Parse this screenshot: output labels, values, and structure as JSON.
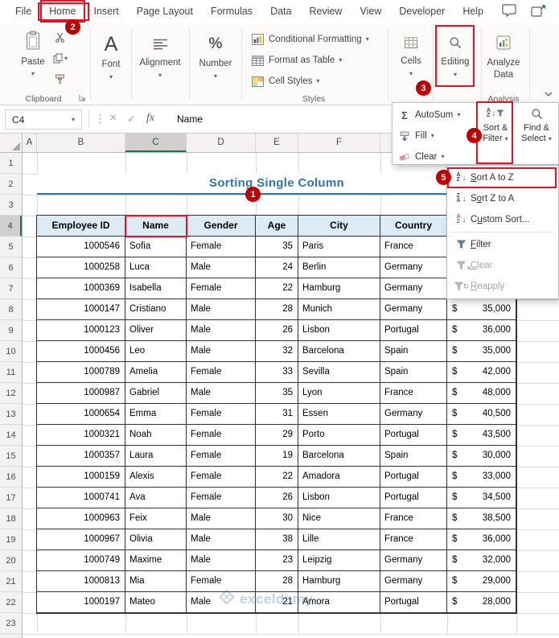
{
  "colors": {
    "annotation_red": "#c00000",
    "excel_green": "#107c41",
    "title_blue": "#2e74b5",
    "table_header_fill": "#ddebf7"
  },
  "ribbon": {
    "tabs": [
      "File",
      "Home",
      "Insert",
      "Page Layout",
      "Formulas",
      "Data",
      "Review",
      "View",
      "Developer",
      "Help"
    ],
    "active_tab": "Home",
    "paste_label": "Paste",
    "clipboard_group": "Clipboard",
    "font_label": "Font",
    "alignment_label": "Alignment",
    "number_label": "Number",
    "styles_items": [
      "Conditional Formatting",
      "Format as Table",
      "Cell Styles"
    ],
    "styles_group": "Styles",
    "cells_label": "Cells",
    "editing_label": "Editing",
    "analyze_label": "Analyze Data",
    "analysis_group": "Analysis"
  },
  "editing_panel": {
    "autosum_label": "AutoSum",
    "fill_label": "Fill",
    "clear_label": "Clear",
    "sort_filter_label": "Sort & Filter",
    "find_select_label": "Find & Select"
  },
  "sort_menu": {
    "items": [
      {
        "label": "Sort A to Z",
        "accel": "S",
        "disabled": false
      },
      {
        "label": "Sort Z to A",
        "accel": "o",
        "disabled": false
      },
      {
        "label": "Custom Sort...",
        "accel": "u",
        "disabled": false
      },
      {
        "label": "Filter",
        "accel": "F",
        "disabled": false
      },
      {
        "label": "Clear",
        "accel": "C",
        "disabled": true
      },
      {
        "label": "Reapply",
        "accel": "R",
        "disabled": true
      }
    ]
  },
  "formula_bar": {
    "name_box": "C4",
    "fx_label": "fx",
    "value": "Name"
  },
  "sheet": {
    "title": "Sorting Single Column",
    "visible_columns": [
      "A",
      "B",
      "C",
      "D",
      "E",
      "F"
    ],
    "selected_column": "C",
    "selected_row": 4,
    "row_numbers": [
      "1",
      "2",
      "3",
      "4",
      "5",
      "6",
      "7",
      "8",
      "9",
      "10",
      "11",
      "12",
      "13",
      "14",
      "15",
      "16",
      "17",
      "18",
      "19",
      "20",
      "21",
      "22",
      "23"
    ],
    "table": {
      "currency_symbol": "$",
      "headers": [
        "Employee ID",
        "Name",
        "Gender",
        "Age",
        "City",
        "Country",
        ""
      ],
      "rows": [
        [
          "1000546",
          "Sofia",
          "Female",
          "35",
          "Paris",
          "France",
          ""
        ],
        [
          "1000258",
          "Luca",
          "Male",
          "24",
          "Berlin",
          "Germany",
          ""
        ],
        [
          "1000369",
          "Isabella",
          "Female",
          "22",
          "Hamburg",
          "Germany",
          ""
        ],
        [
          "1000147",
          "Cristiano",
          "Male",
          "28",
          "Munich",
          "Germany",
          "35,000"
        ],
        [
          "1000123",
          "Oliver",
          "Male",
          "26",
          "Lisbon",
          "Portugal",
          "36,000"
        ],
        [
          "1000456",
          "Leo",
          "Male",
          "32",
          "Barcelona",
          "Spain",
          "35,000"
        ],
        [
          "1000789",
          "Amelia",
          "Female",
          "33",
          "Sevilla",
          "Spain",
          "42,000"
        ],
        [
          "1000987",
          "Gabriel",
          "Male",
          "35",
          "Lyon",
          "France",
          "48,000"
        ],
        [
          "1000654",
          "Emma",
          "Female",
          "31",
          "Essen",
          "Germany",
          "40,500"
        ],
        [
          "1000321",
          "Noah",
          "Female",
          "29",
          "Porto",
          "Portugal",
          "43,500"
        ],
        [
          "1000357",
          "Laura",
          "Female",
          "19",
          "Barcelona",
          "Spain",
          "30,000"
        ],
        [
          "1000159",
          "Alexis",
          "Female",
          "22",
          "Amadora",
          "Portugal",
          "33,000"
        ],
        [
          "1000741",
          "Ava",
          "Female",
          "26",
          "Lisbon",
          "Portugal",
          "34,500"
        ],
        [
          "1000963",
          "Feix",
          "Male",
          "30",
          "Nice",
          "France",
          "38,500"
        ],
        [
          "1000967",
          "Olivia",
          "Male",
          "38",
          "Lille",
          "France",
          "36,000"
        ],
        [
          "1000749",
          "Maxime",
          "Male",
          "23",
          "Leipzig",
          "Germany",
          "32,000"
        ],
        [
          "1000813",
          "Mia",
          "Female",
          "28",
          "Hamburg",
          "Germany",
          "29,000"
        ],
        [
          "1000197",
          "Mateo",
          "Male",
          "21",
          "Amora",
          "Portugal",
          "28,000"
        ]
      ]
    }
  },
  "annotations": {
    "steps": [
      "1",
      "2",
      "3",
      "4",
      "5"
    ]
  },
  "watermark": {
    "text": "exceldemy"
  }
}
